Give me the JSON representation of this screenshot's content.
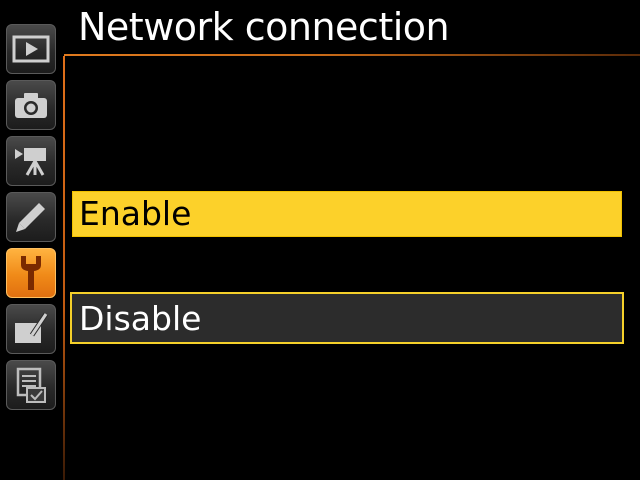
{
  "header": {
    "title": "Network connection"
  },
  "sidebar": {
    "tabs": [
      {
        "name": "playback",
        "icon": "playback-icon",
        "active": false
      },
      {
        "name": "photo-shooting",
        "icon": "camera-icon",
        "active": false
      },
      {
        "name": "movie-shooting",
        "icon": "movie-camera-icon",
        "active": false
      },
      {
        "name": "custom-settings",
        "icon": "pencil-icon",
        "active": false
      },
      {
        "name": "setup",
        "icon": "wrench-icon",
        "active": true
      },
      {
        "name": "retouch",
        "icon": "retouch-brush-icon",
        "active": false
      },
      {
        "name": "my-menu",
        "icon": "my-menu-icon",
        "active": false
      }
    ]
  },
  "options": [
    {
      "label": "Enable",
      "selected": true
    },
    {
      "label": "Disable",
      "selected": false
    }
  ],
  "colors": {
    "accent_orange": "#f08a18",
    "selection_yellow": "#fcd12a",
    "background": "#000000"
  }
}
